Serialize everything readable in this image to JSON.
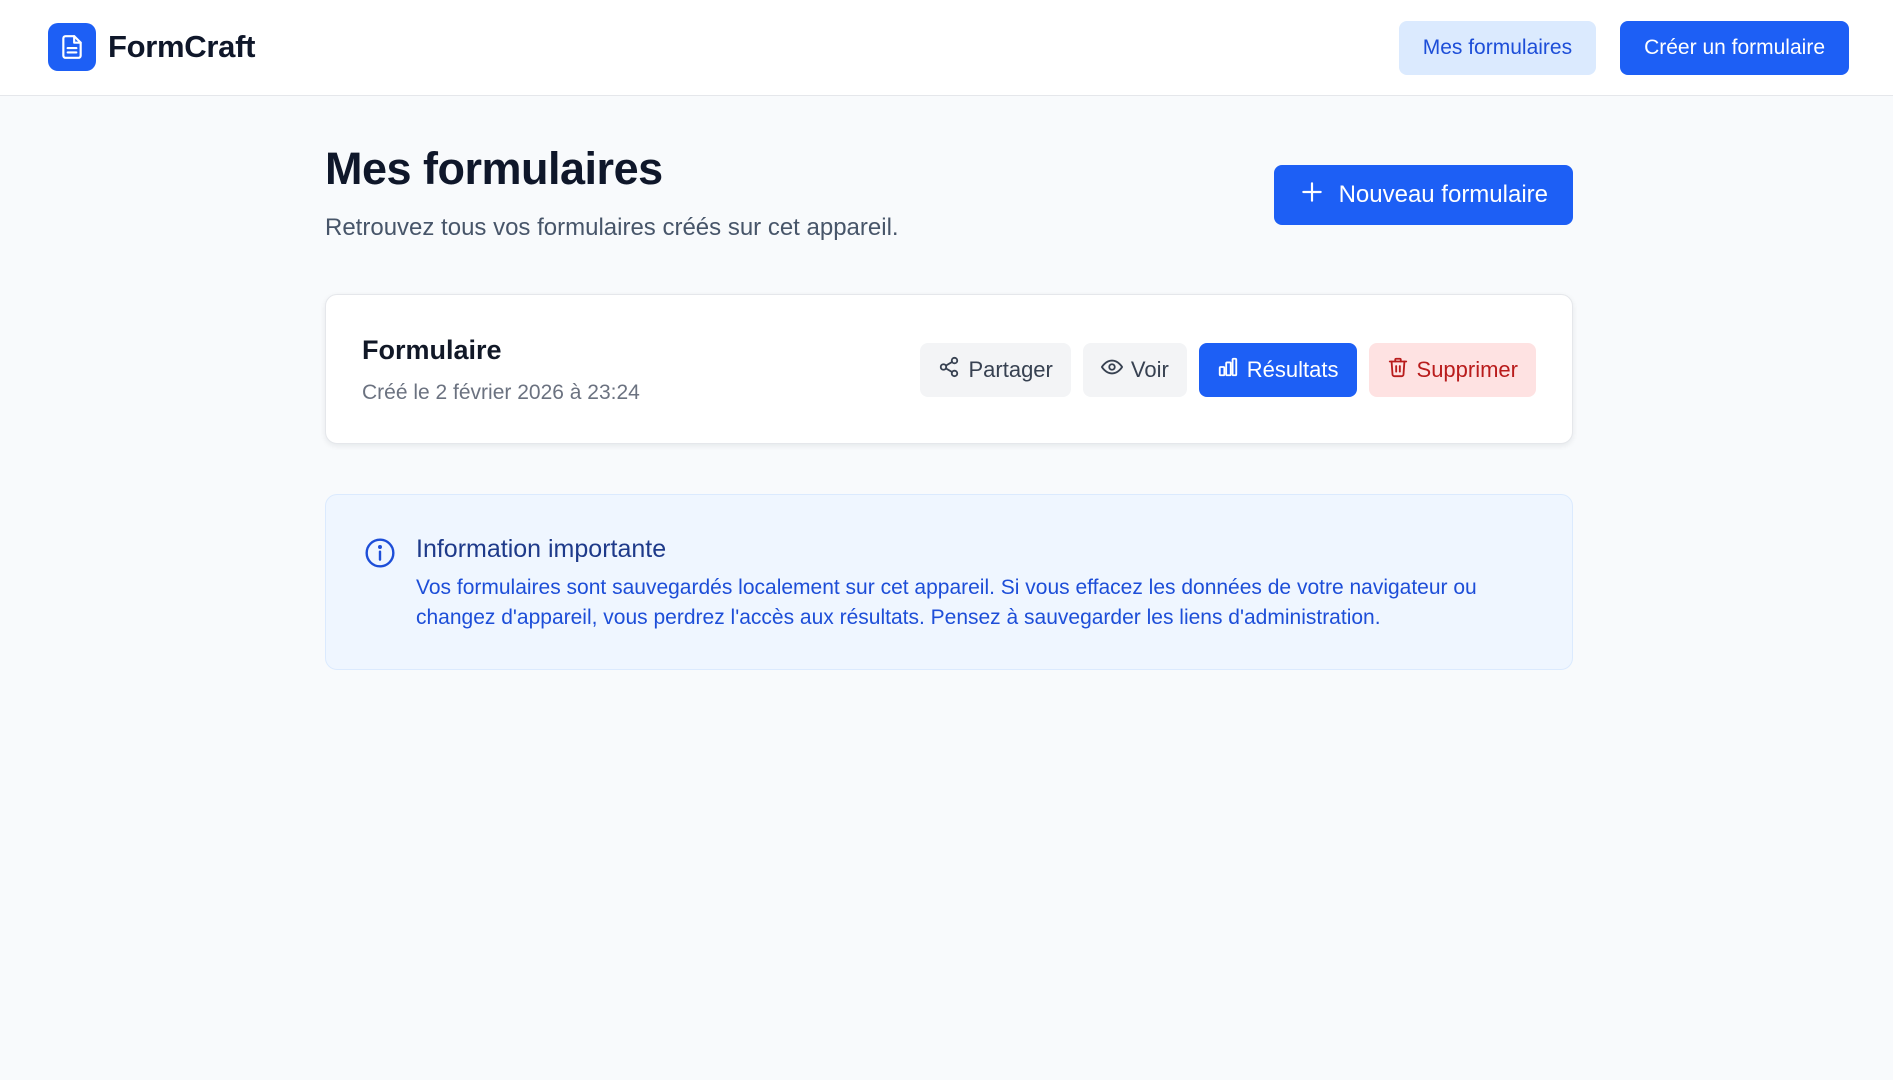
{
  "colors": {
    "accent": "#1d5ff5",
    "accent_light": "#dbeafe",
    "danger": "#b91c1c",
    "danger_light": "#fee2e2",
    "background": "#f8fafc"
  },
  "header": {
    "brand_name": "FormCraft",
    "brand_icon": "document-icon",
    "nav": {
      "my_forms_label": "Mes formulaires",
      "create_label": "Créer un formulaire"
    }
  },
  "page": {
    "title": "Mes formulaires",
    "subtitle": "Retrouvez tous vos formulaires créés sur cet appareil.",
    "new_button_label": "Nouveau formulaire",
    "new_button_icon": "plus-icon"
  },
  "forms": [
    {
      "name": "Formulaire",
      "created": "Créé le 2 février 2026 à 23:24",
      "actions": {
        "share": {
          "label": "Partager",
          "icon": "share-icon"
        },
        "view": {
          "label": "Voir",
          "icon": "eye-icon"
        },
        "results": {
          "label": "Résultats",
          "icon": "bar-chart-icon"
        },
        "delete": {
          "label": "Supprimer",
          "icon": "trash-icon"
        }
      }
    }
  ],
  "info": {
    "icon": "info-icon",
    "title": "Information importante",
    "text": "Vos formulaires sont sauvegardés localement sur cet appareil. Si vous effacez les données de votre navigateur ou changez d'appareil, vous perdrez l'accès aux résultats. Pensez à sauvegarder les liens d'administration."
  }
}
